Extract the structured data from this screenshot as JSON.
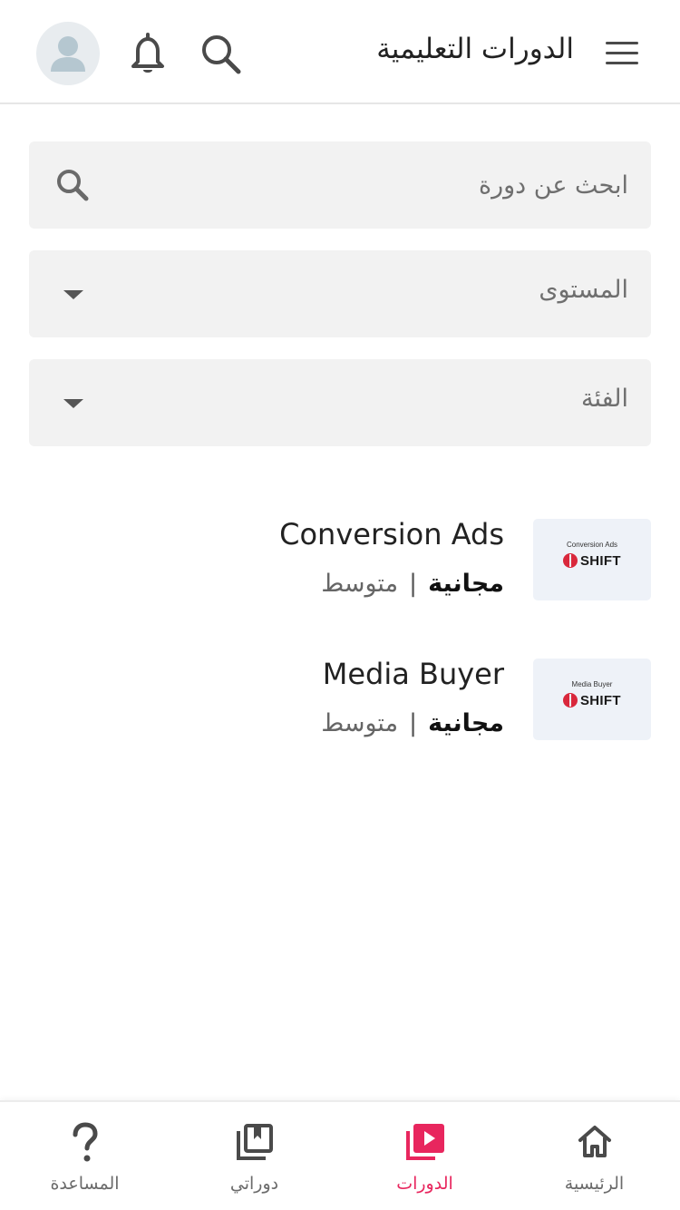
{
  "header": {
    "title": "الدورات التعليمية",
    "menu_icon": "menu-icon",
    "search_icon": "search-icon",
    "bell_icon": "bell-icon",
    "avatar_icon": "user-icon"
  },
  "filters": {
    "search_placeholder": "ابحث عن دورة",
    "level_label": "المستوى",
    "category_label": "الفئة"
  },
  "courses": [
    {
      "title": "Conversion Ads",
      "price": "مجانية",
      "separator": "|",
      "level": "متوسط",
      "thumb_caption": "Conversion Ads",
      "thumb_brand": "SHIFT"
    },
    {
      "title": "Media Buyer",
      "price": "مجانية",
      "separator": "|",
      "level": "متوسط",
      "thumb_caption": "Media Buyer",
      "thumb_brand": "SHIFT"
    }
  ],
  "bottom_nav": [
    {
      "label": "الرئيسية",
      "icon": "home-icon",
      "active": false
    },
    {
      "label": "الدورات",
      "icon": "play-library-icon",
      "active": true
    },
    {
      "label": "دوراتي",
      "icon": "bookmark-library-icon",
      "active": false
    },
    {
      "label": "المساعدة",
      "icon": "question-icon",
      "active": false
    }
  ],
  "colors": {
    "accent": "#e8265e",
    "field_bg": "#f2f2f2",
    "icon_gray": "#4a4a4a",
    "brand_red": "#d9283c"
  }
}
